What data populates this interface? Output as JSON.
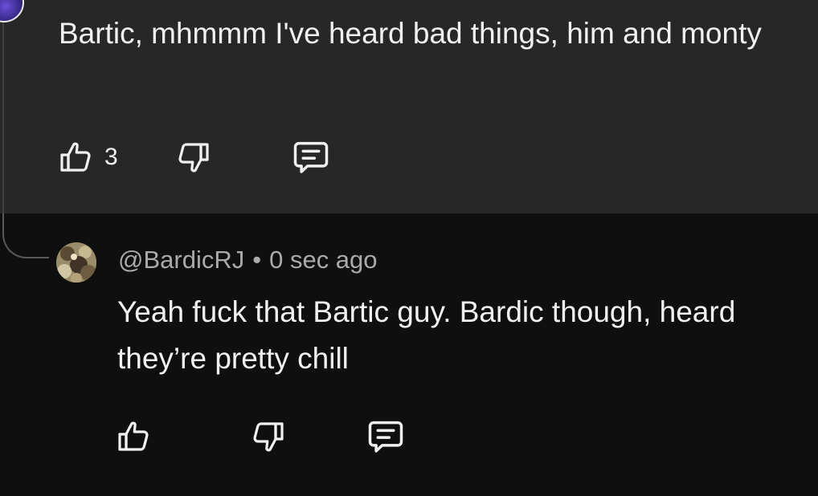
{
  "parent_comment": {
    "text": "Bartic, mhmmm I've heard bad things, him and monty",
    "like_count": "3"
  },
  "reply": {
    "handle": "@BardicRJ",
    "separator": "•",
    "timestamp": "0 sec ago",
    "text": "Yeah fuck that Bartic guy. Bardic though, heard they’re pretty chill"
  },
  "icons": {
    "like": "thumbs-up-icon",
    "dislike": "thumbs-down-icon",
    "reply": "comment-icon"
  },
  "colors": {
    "highlight_background": "#272727",
    "page_background": "#0f0f0f",
    "primary_text": "#f1f1f1",
    "secondary_text": "#aaaaaa"
  }
}
